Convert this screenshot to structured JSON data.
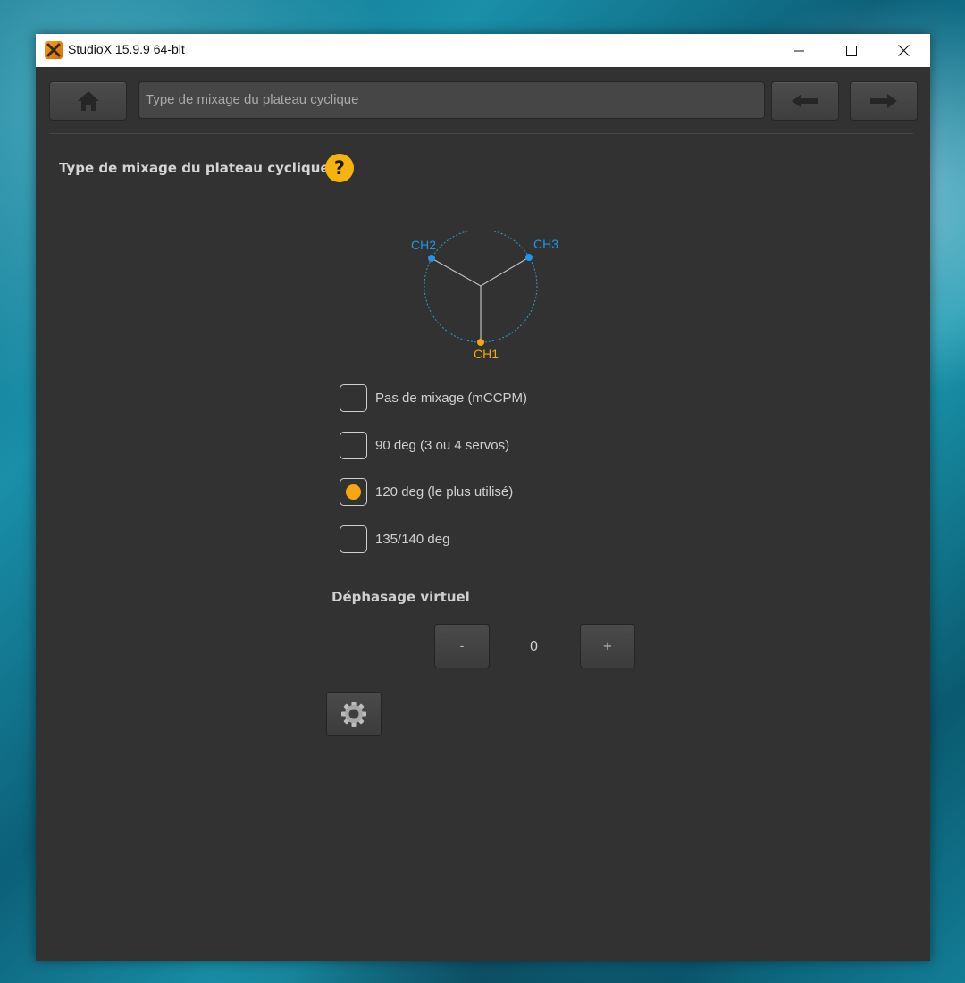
{
  "window": {
    "title": "StudioX 15.9.9  64-bit"
  },
  "toolbar": {
    "breadcrumb": "Type de mixage du plateau cyclique"
  },
  "page": {
    "title": "Type de mixage du plateau cyclique",
    "help_symbol": "?"
  },
  "swashplate": {
    "channels": [
      "CH2",
      "CH3",
      "CH1"
    ],
    "colors": {
      "servo": "#2196e6",
      "primary": "#f6a70f",
      "circle": "#2b9fd0",
      "spokes": "#bdbdbd"
    }
  },
  "mix_options": [
    {
      "label": "Pas de mixage (mCCPM)",
      "selected": false
    },
    {
      "label": "90 deg (3 ou 4 servos)",
      "selected": false
    },
    {
      "label": "120 deg (le plus utilisé)",
      "selected": true
    },
    {
      "label": "135/140 deg",
      "selected": false
    }
  ],
  "phase": {
    "title": "Déphasage virtuel",
    "minus_label": "-",
    "value": "0",
    "plus_label": "+"
  },
  "colors": {
    "accent": "#f6b30f",
    "background": "#323232"
  }
}
